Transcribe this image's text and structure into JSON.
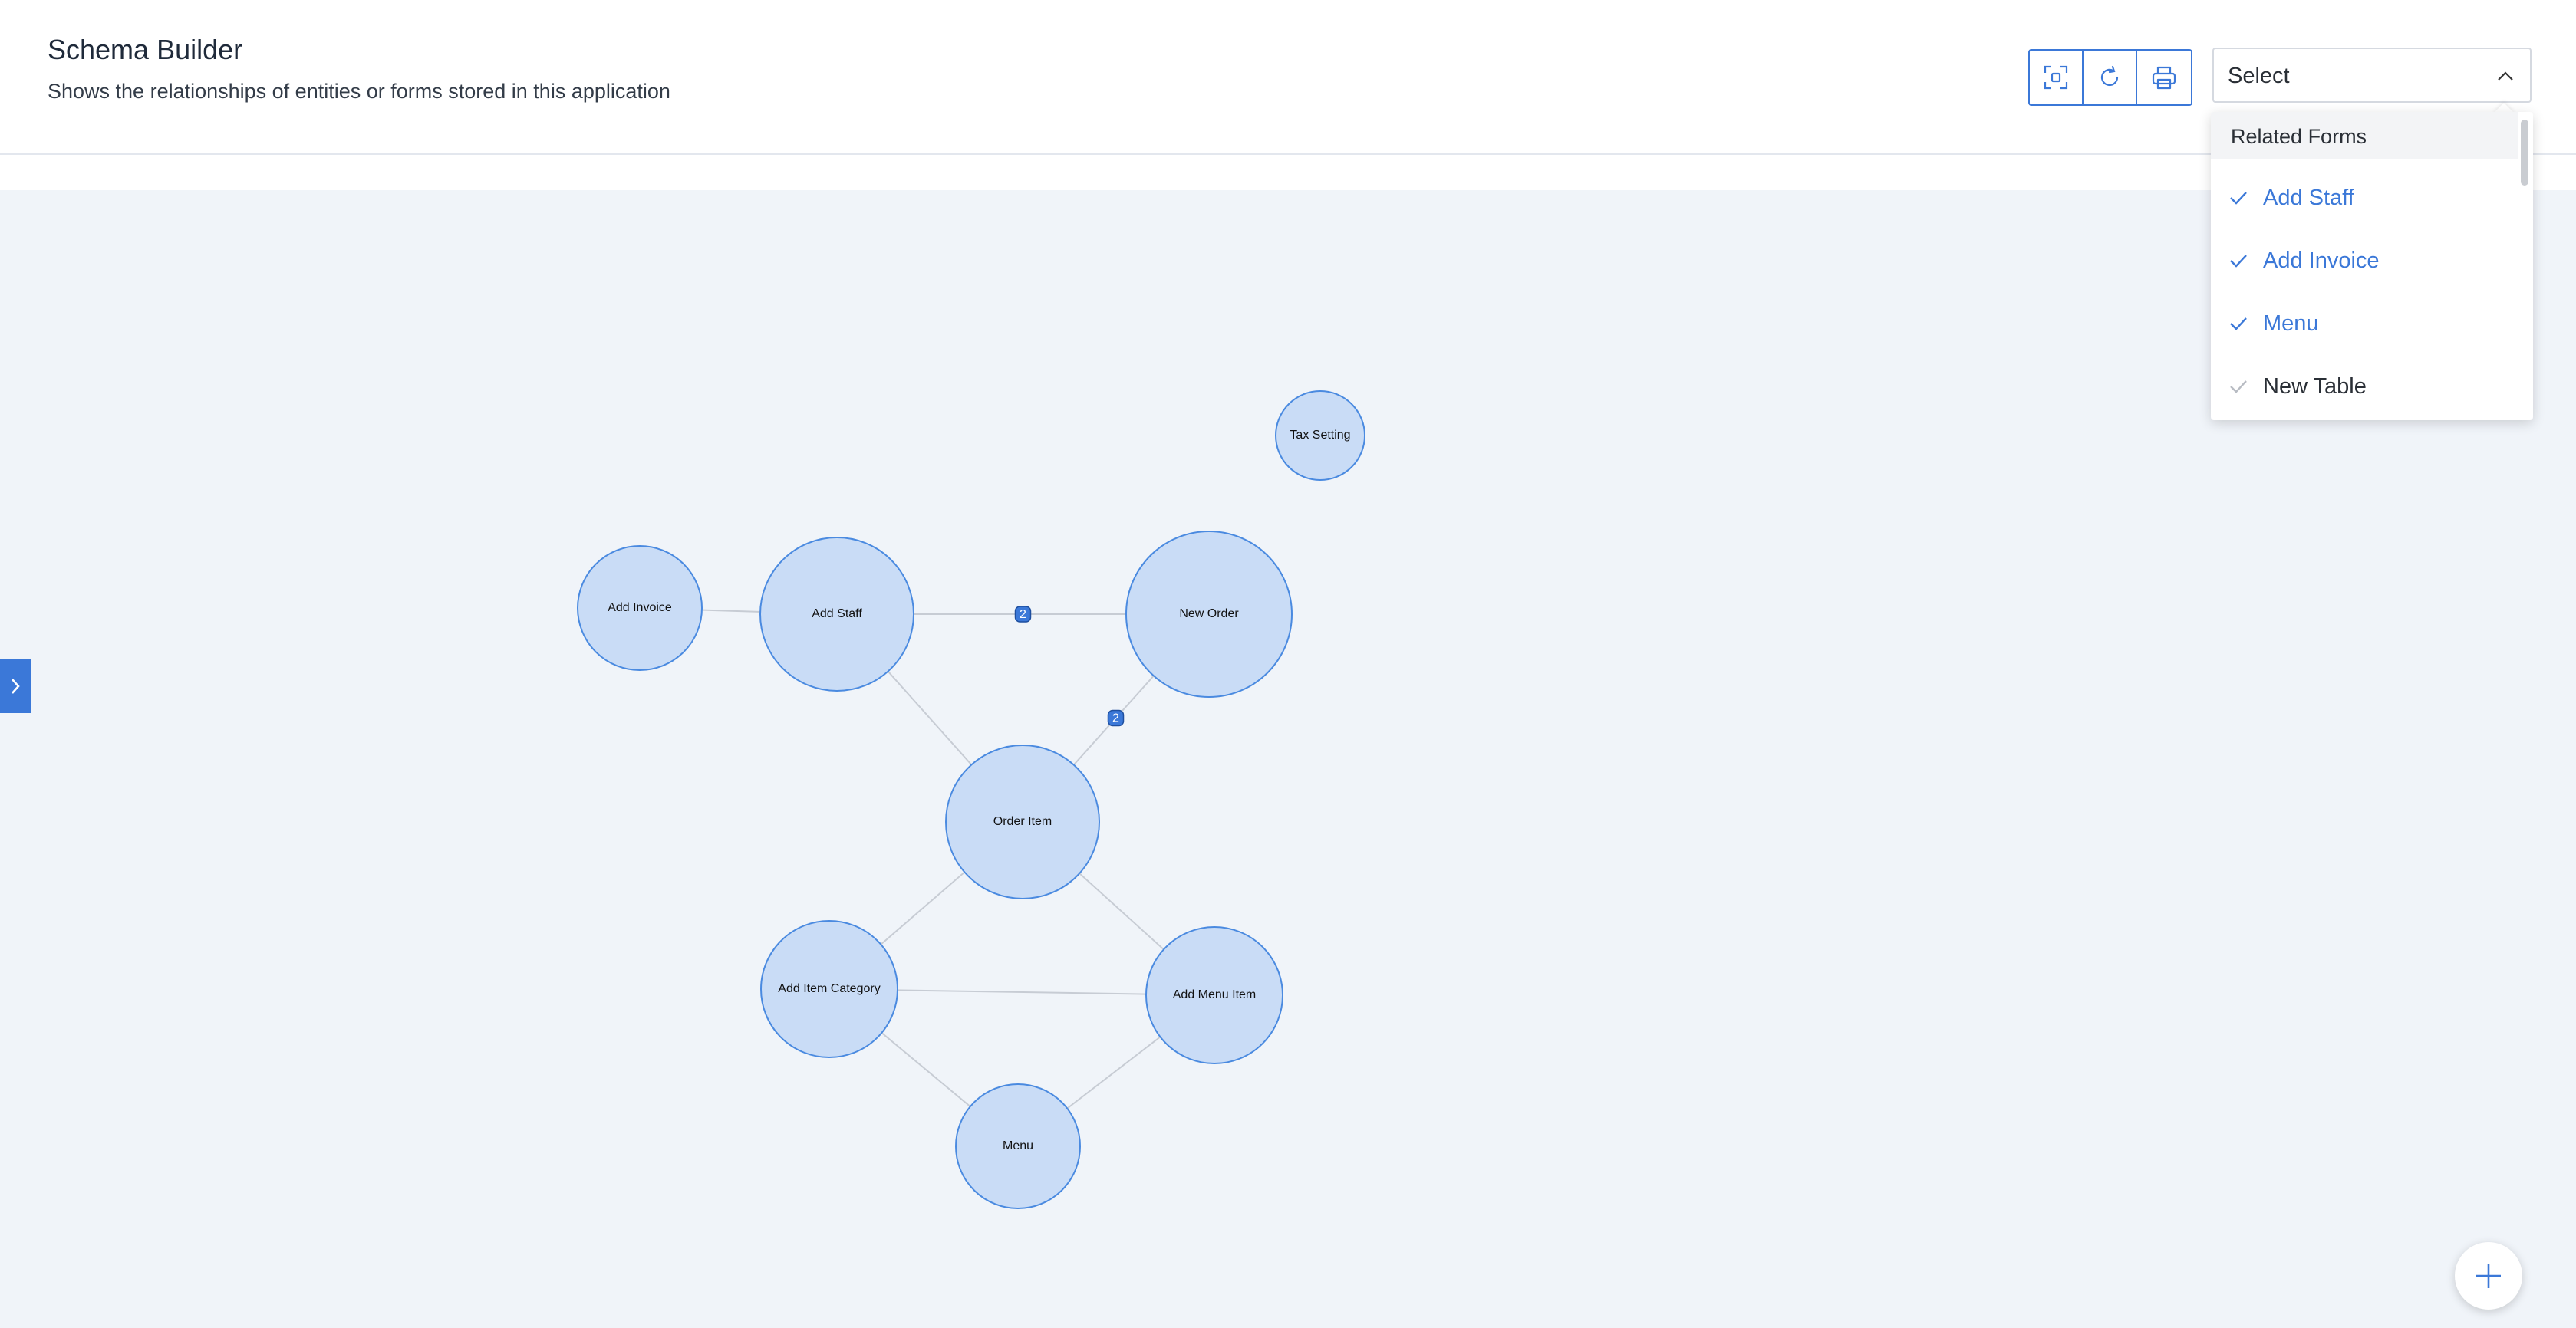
{
  "header": {
    "title": "Schema Builder",
    "subtitle": "Shows the relationships of entities or forms stored in this application"
  },
  "toolbar": {
    "buttons": [
      {
        "icon": "fit-to-screen-icon"
      },
      {
        "icon": "refresh-icon"
      },
      {
        "icon": "print-icon"
      }
    ]
  },
  "select": {
    "label": "Select",
    "expanded": true
  },
  "dropdown": {
    "group_label": "Related Forms",
    "items": [
      {
        "label": "Add Staff",
        "checked": true
      },
      {
        "label": "Add Invoice",
        "checked": true
      },
      {
        "label": "Menu",
        "checked": true
      },
      {
        "label": "New Table",
        "checked": false
      }
    ]
  },
  "graph": {
    "nodes": [
      {
        "id": "tax-setting",
        "label": "Tax Setting"
      },
      {
        "id": "add-invoice",
        "label": "Add Invoice"
      },
      {
        "id": "add-staff",
        "label": "Add Staff"
      },
      {
        "id": "new-order",
        "label": "New Order"
      },
      {
        "id": "order-item",
        "label": "Order Item"
      },
      {
        "id": "add-item-category",
        "label": "Add Item Category"
      },
      {
        "id": "add-menu-item",
        "label": "Add Menu Item"
      },
      {
        "id": "menu",
        "label": "Menu"
      }
    ],
    "edges": [
      {
        "from": "add-invoice",
        "to": "add-staff"
      },
      {
        "from": "add-staff",
        "to": "new-order",
        "badge": "2"
      },
      {
        "from": "add-staff",
        "to": "order-item"
      },
      {
        "from": "new-order",
        "to": "order-item",
        "badge": "2"
      },
      {
        "from": "order-item",
        "to": "add-item-category"
      },
      {
        "from": "order-item",
        "to": "add-menu-item"
      },
      {
        "from": "add-item-category",
        "to": "add-menu-item"
      },
      {
        "from": "add-item-category",
        "to": "menu"
      },
      {
        "from": "add-menu-item",
        "to": "menu"
      }
    ]
  },
  "colors": {
    "accent": "#3b78d8",
    "node_fill": "#c9dcf6",
    "node_stroke": "#4a8ae0",
    "canvas_bg": "#f0f4f9",
    "edge": "#c7ccd4"
  }
}
